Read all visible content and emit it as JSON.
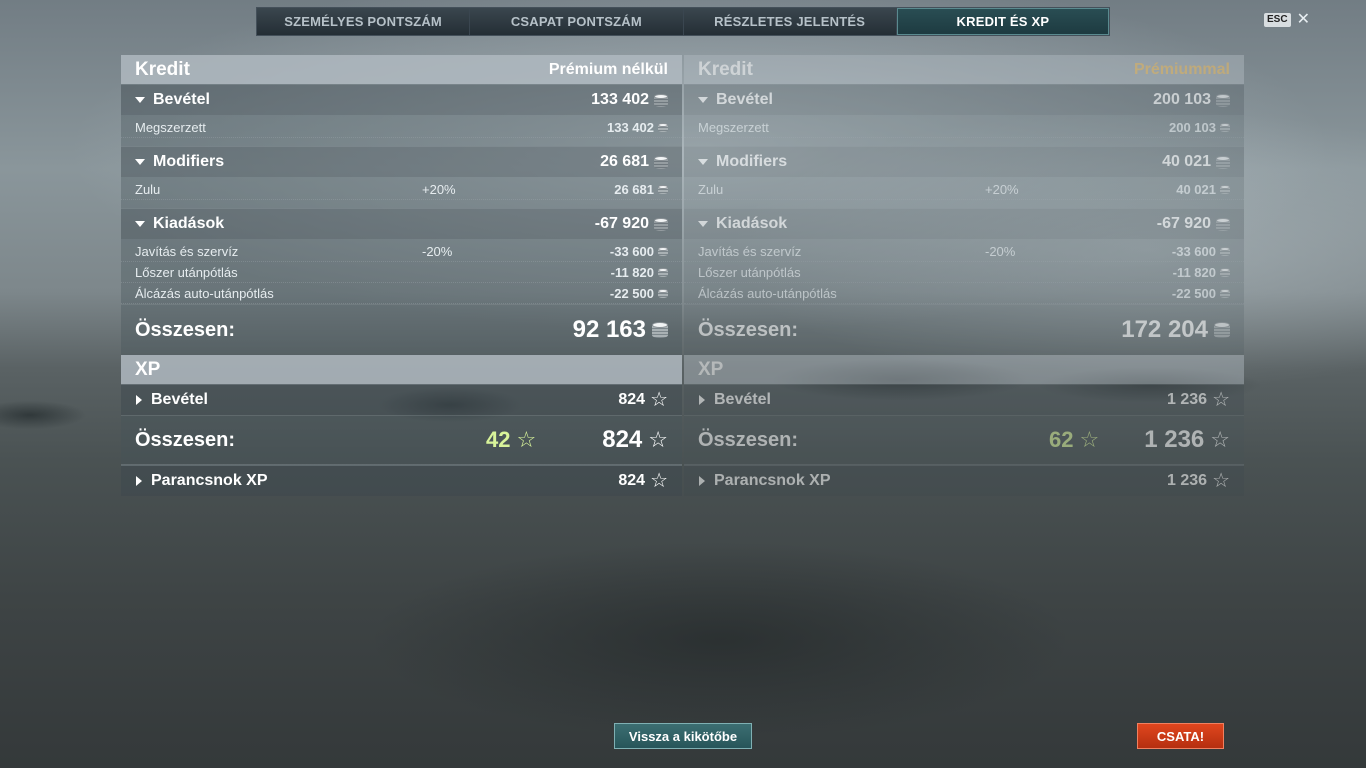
{
  "tabs": [
    {
      "label": "SZEMÉLYES PONTSZÁM"
    },
    {
      "label": "CSAPAT PONTSZÁM"
    },
    {
      "label": "RÉSZLETES JELENTÉS"
    },
    {
      "label": "KREDIT ÉS XP"
    }
  ],
  "esc_label": "ESC",
  "close_label": "✕",
  "left": {
    "title": "Kredit",
    "subtitle": "Prémium nélkül",
    "income": {
      "label": "Bevétel",
      "value": "133 402",
      "rows": [
        {
          "label": "Megszerzett",
          "value": "133 402"
        }
      ]
    },
    "modifiers": {
      "label": "Modifiers",
      "value": "26 681",
      "rows": [
        {
          "label": "Zulu",
          "pct": "+20%",
          "value": "26 681"
        }
      ]
    },
    "expenses": {
      "label": "Kiadások",
      "value": "-67 920",
      "rows": [
        {
          "label": "Javítás és szervíz",
          "pct": "-20%",
          "value": "-33 600"
        },
        {
          "label": "Lőszer utánpótlás",
          "value": "-11 820"
        },
        {
          "label": "Álcázás auto-utánpótlás",
          "value": "-22 500"
        }
      ]
    },
    "total_label": "Összesen:",
    "total_value": "92 163",
    "xp_title": "XP",
    "xp_income": {
      "label": "Bevétel",
      "value": "824"
    },
    "xp_total_label": "Összesen:",
    "xp_bonus": "42",
    "xp_total_value": "824",
    "commander_xp": {
      "label": "Parancsnok XP",
      "value": "824"
    }
  },
  "right": {
    "title": "Kredit",
    "subtitle": "Prémiummal",
    "income": {
      "label": "Bevétel",
      "value": "200 103",
      "rows": [
        {
          "label": "Megszerzett",
          "value": "200 103"
        }
      ]
    },
    "modifiers": {
      "label": "Modifiers",
      "value": "40 021",
      "rows": [
        {
          "label": "Zulu",
          "pct": "+20%",
          "value": "40 021"
        }
      ]
    },
    "expenses": {
      "label": "Kiadások",
      "value": "-67 920",
      "rows": [
        {
          "label": "Javítás és szervíz",
          "pct": "-20%",
          "value": "-33 600"
        },
        {
          "label": "Lőszer utánpótlás",
          "value": "-11 820"
        },
        {
          "label": "Álcázás auto-utánpótlás",
          "value": "-22 500"
        }
      ]
    },
    "total_label": "Összesen:",
    "total_value": "172 204",
    "xp_title": "XP",
    "xp_income": {
      "label": "Bevétel",
      "value": "1 236"
    },
    "xp_total_label": "Összesen:",
    "xp_bonus": "62",
    "xp_total_value": "1 236",
    "commander_xp": {
      "label": "Parancsnok XP",
      "value": "1 236"
    }
  },
  "buttons": {
    "port": "Vissza a kikötőbe",
    "battle": "CSATA!"
  },
  "icons": {
    "credit": "coin-stack-icon",
    "xp": "star-icon",
    "collapse": "triangle-down-icon",
    "expand": "triangle-right-icon"
  },
  "colors": {
    "premium_accent": "#f3c46a",
    "xp_bonus": "#d8f39a",
    "active_tab": "#2a4e54",
    "battle_button": "#e0461e",
    "port_button": "#3c6e72"
  }
}
